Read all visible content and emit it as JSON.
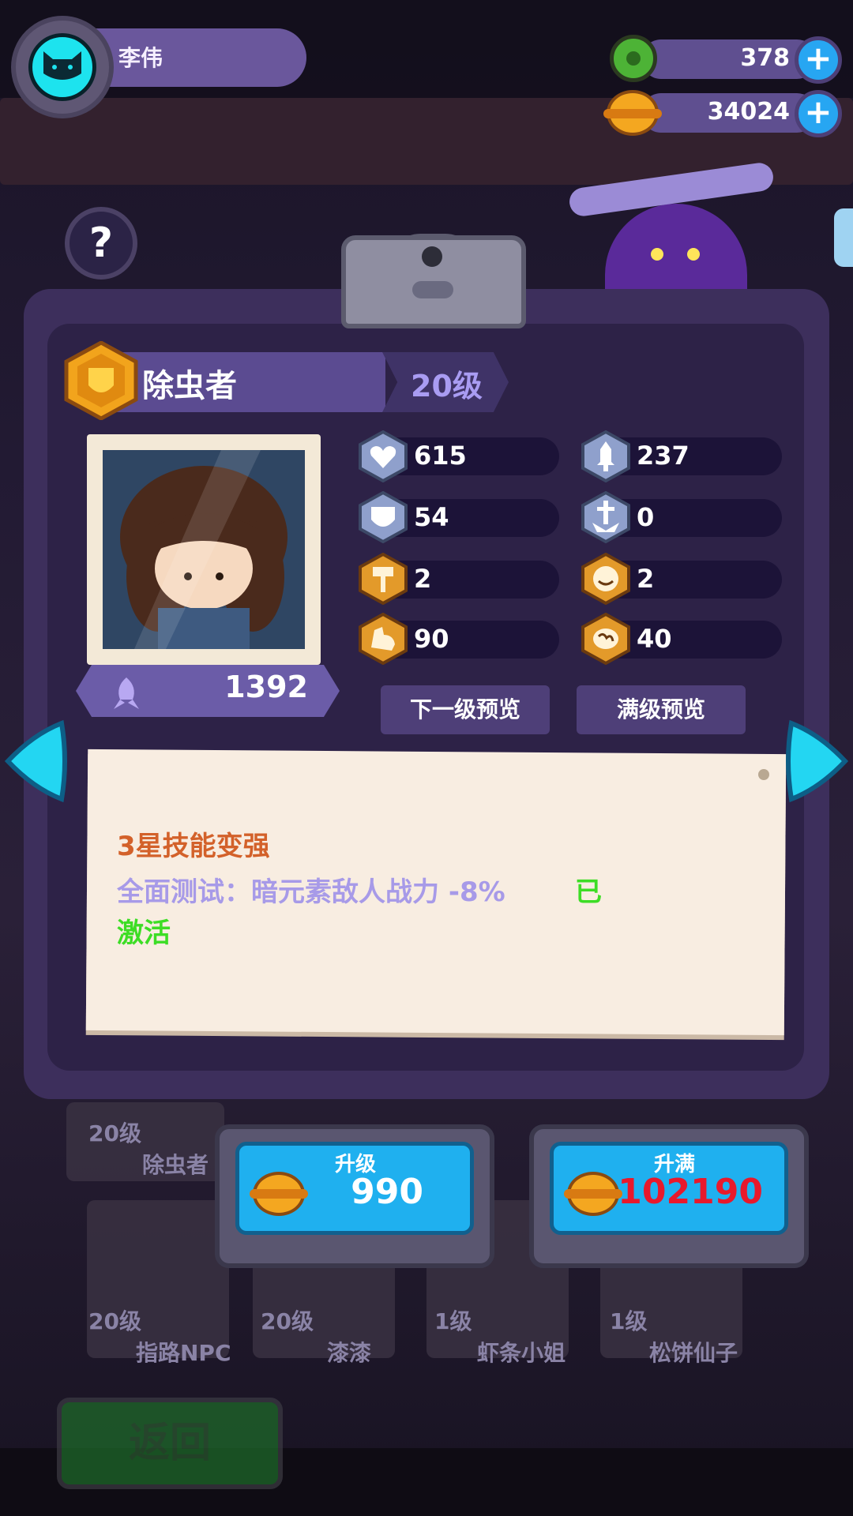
{
  "player": {
    "name": "李伟"
  },
  "resources": [
    {
      "name": "gem",
      "value": "378",
      "color": "#59c03a"
    },
    {
      "name": "coin",
      "value": "34024",
      "color": "#f4a720"
    }
  ],
  "help": {
    "label": "?"
  },
  "character": {
    "title": "除虫者",
    "level": "20级",
    "power": "1392"
  },
  "stats": [
    {
      "icon": "heart-icon",
      "value": "615"
    },
    {
      "icon": "attack-icon",
      "value": "237"
    },
    {
      "icon": "shield-icon",
      "value": "54"
    },
    {
      "icon": "sword-defense-icon",
      "value": "0"
    },
    {
      "icon": "hammer-icon",
      "value": "2"
    },
    {
      "icon": "smile-icon",
      "value": "2"
    },
    {
      "icon": "muscle-icon",
      "value": "90"
    },
    {
      "icon": "brain-icon",
      "value": "40"
    }
  ],
  "buttons": {
    "next_preview": "下一级预览",
    "max_preview": "满级预览"
  },
  "note": {
    "title": "3星技能变强",
    "line": "全面测试：暗元素敌人战力 -8%",
    "active_part1": "已",
    "active_part2": "激活"
  },
  "roster": [
    {
      "level": "20级",
      "name": "除虫者"
    },
    {
      "level": "20级",
      "name": "指路NPC"
    },
    {
      "level": "20级",
      "name": "漆漆"
    },
    {
      "level": "1级",
      "name": "虾条小姐"
    },
    {
      "level": "1级",
      "name": "松饼仙子"
    }
  ],
  "upgrade": {
    "label": "升级",
    "cost": "990"
  },
  "upgrade_max": {
    "label": "升满",
    "cost": "102190"
  },
  "back": {
    "label": "返回"
  },
  "colors": {
    "accent": "#1fb0ef",
    "panel": "#3d2f5c",
    "cost_red": "#e8192c",
    "active_green": "#3ddd25"
  }
}
